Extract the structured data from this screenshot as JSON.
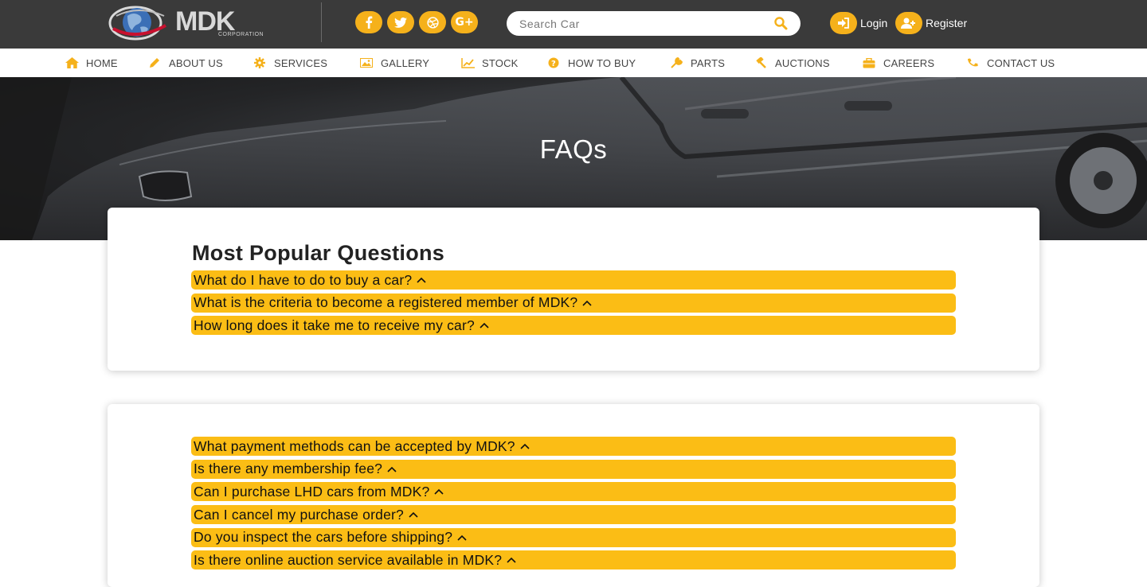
{
  "brand": {
    "name": "MDK",
    "subtitle": "CORPORATION"
  },
  "social": [
    {
      "name": "facebook",
      "glyph": "f"
    },
    {
      "name": "twitter",
      "glyph": "t"
    },
    {
      "name": "dribbble",
      "glyph": "d"
    },
    {
      "name": "google-plus",
      "glyph": "G+"
    }
  ],
  "search": {
    "placeholder": "Search Car",
    "value": ""
  },
  "auth": {
    "login_label": "Login",
    "register_label": "Register"
  },
  "nav": {
    "items": [
      {
        "label": "HOME",
        "icon": "home-icon"
      },
      {
        "label": "ABOUT US",
        "icon": "pencil-icon"
      },
      {
        "label": "SERVICES",
        "icon": "gear-icon"
      },
      {
        "label": "GALLERY",
        "icon": "image-icon"
      },
      {
        "label": "STOCK",
        "icon": "chart-icon"
      },
      {
        "label": "HOW TO BUY",
        "icon": "question-icon"
      },
      {
        "label": "PARTS",
        "icon": "wrench-icon"
      },
      {
        "label": "AUCTIONS",
        "icon": "gavel-icon"
      },
      {
        "label": "CAREERS",
        "icon": "briefcase-icon"
      },
      {
        "label": "CONTACT US",
        "icon": "phone-icon"
      }
    ]
  },
  "hero": {
    "title": "FAQs"
  },
  "popular": {
    "heading": "Most Popular Questions",
    "questions": [
      "What do I have to do to buy a car?",
      "What is the criteria to become a registered member of MDK?",
      "How long does it take me to receive my car?"
    ]
  },
  "general": {
    "questions": [
      "What payment methods can be accepted by MDK?",
      "Is there any membership fee?",
      "Can I purchase LHD cars from MDK?",
      "Can I cancel my purchase order?",
      "Do you inspect the cars before shipping?",
      "Is there online auction service available in MDK?"
    ]
  },
  "colors": {
    "accent": "#fbbd15",
    "topbar": "#3a3a3a",
    "icon_accent": "#f5b11b"
  }
}
